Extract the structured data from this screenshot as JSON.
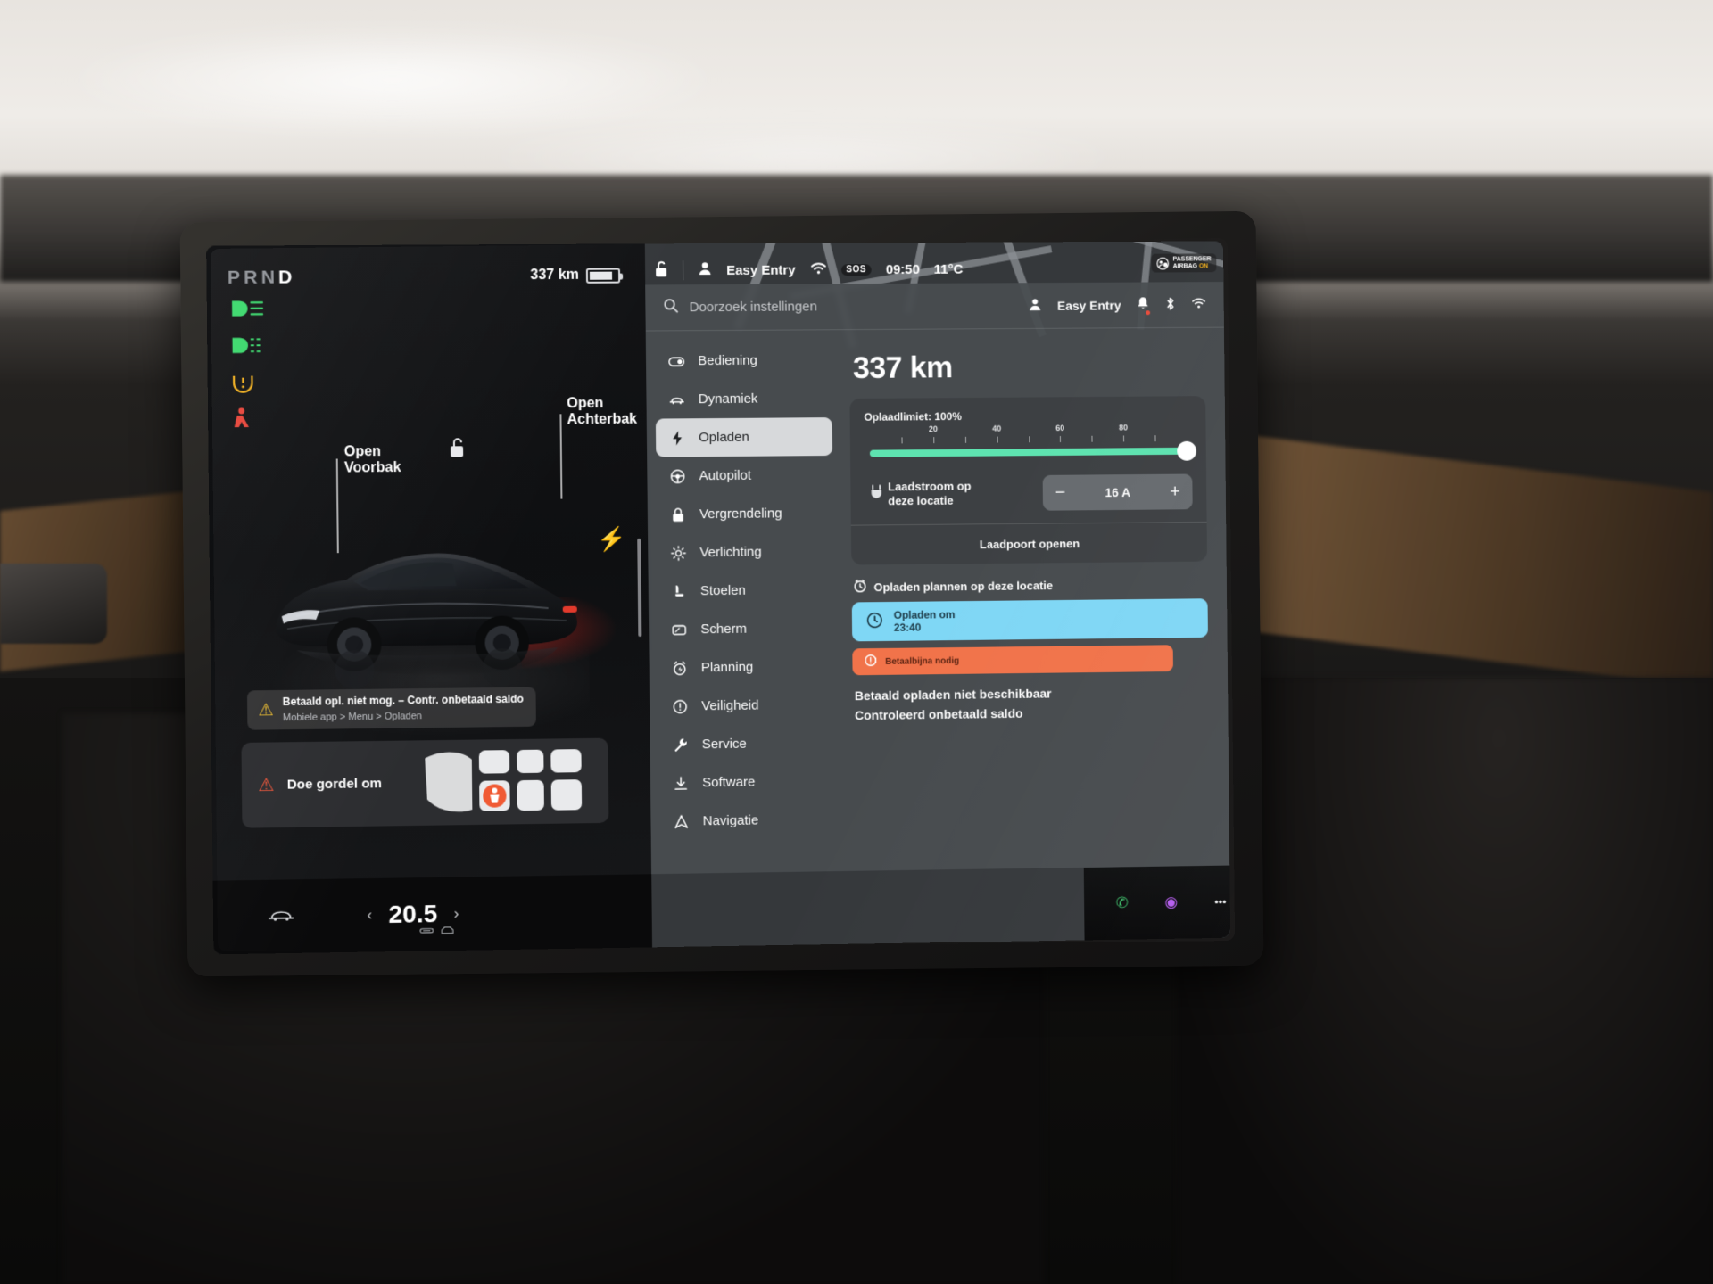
{
  "drive": {
    "gear_display": "PRND",
    "gear_active": "D",
    "range_top": "337 km",
    "telltales": [
      {
        "name": "high-beam-icon",
        "color": "#39d96b"
      },
      {
        "name": "fog-light-icon",
        "color": "#39d96b"
      },
      {
        "name": "tire-pressure-icon",
        "color": "#f2b01e"
      },
      {
        "name": "seatbelt-warning-icon",
        "color": "#e8453a"
      }
    ],
    "frunk_label": "Open\nVoorbak",
    "frunk_label_l1": "Open",
    "frunk_label_l2": "Voorbak",
    "trunk_label_l1": "Open",
    "trunk_label_l2": "Achterbak",
    "warn_card_title": "Betaald opl. niet mog. – Contr. onbetaald saldo",
    "warn_card_sub": "Mobiele app > Menu > Opladen",
    "seatbelt_card_label": "Doe gordel om"
  },
  "statusbar": {
    "range": "337 km",
    "lock": "unlocked-lock-icon",
    "profile": "Easy Entry",
    "wifi": "wifi-icon",
    "sos": "SOS",
    "time": "09:50",
    "temperature": "11°C",
    "airbag_l1": "PASSENGER",
    "airbag_l2": "AIRBAG",
    "airbag_state": "ON"
  },
  "settings": {
    "search_placeholder": "Doorzoek instellingen",
    "profile": "Easy Entry",
    "nav": [
      {
        "label": "Bediening",
        "icon": "toggle-icon",
        "active": false
      },
      {
        "label": "Dynamiek",
        "icon": "car-icon",
        "active": false
      },
      {
        "label": "Opladen",
        "icon": "bolt-icon",
        "active": true
      },
      {
        "label": "Autopilot",
        "icon": "steering-wheel-icon",
        "active": false
      },
      {
        "label": "Vergrendeling",
        "icon": "lock-icon",
        "active": false
      },
      {
        "label": "Verlichting",
        "icon": "sun-icon",
        "active": false
      },
      {
        "label": "Stoelen",
        "icon": "seat-icon",
        "active": false
      },
      {
        "label": "Scherm",
        "icon": "display-icon",
        "active": false
      },
      {
        "label": "Planning",
        "icon": "alarm-icon",
        "active": false
      },
      {
        "label": "Veiligheid",
        "icon": "shield-icon",
        "active": false
      },
      {
        "label": "Service",
        "icon": "wrench-icon",
        "active": false
      },
      {
        "label": "Software",
        "icon": "download-icon",
        "active": false
      },
      {
        "label": "Navigatie",
        "icon": "navigation-icon",
        "active": false
      }
    ]
  },
  "charging": {
    "range": "337 km",
    "limit_label": "Oplaadlimiet: 100%",
    "limit_percent": 100,
    "tick_labels": [
      "20",
      "40",
      "60",
      "80"
    ],
    "tick_positions": [
      20,
      40,
      60,
      80
    ],
    "amp_label_l1": "Laadstroom op",
    "amp_label_l2": "deze locatie",
    "amp_value": "16 A",
    "minus": "−",
    "plus": "+",
    "open_port_button": "Laadpoort openen",
    "schedule_header": "Opladen plannen op deze locatie",
    "schedule_button_l1": "Opladen om",
    "schedule_button_l2": "23:40",
    "alert_badge": "Betaalbijna nodig",
    "alert_line1": "Betaald opladen niet beschikbaar",
    "alert_line2": "Controleerd onbetaald saldo"
  },
  "dock": {
    "apps": [
      {
        "name": "phone-icon",
        "glyph": "✆",
        "color": "#3ec46d",
        "bg": "transparent"
      },
      {
        "name": "media-icon",
        "glyph": "◉",
        "color": "#b55cf0",
        "bg": "transparent"
      },
      {
        "name": "more-icon",
        "glyph": "•••",
        "color": "#e6e8ea",
        "bg": "transparent"
      },
      {
        "name": "camera-icon",
        "glyph": "◎",
        "color": "#e8e9eb",
        "bg": "#3a3b3d"
      },
      {
        "name": "energy-icon",
        "glyph": "〜",
        "color": "#0b2f16",
        "bg": "#49d96a"
      },
      {
        "name": "calendar-icon",
        "glyph": "▢",
        "color": "#0b3a44",
        "bg": "#5fe0f5"
      },
      {
        "name": "music-icon",
        "glyph": "♪",
        "color": "#fff",
        "bg": "#f0407a"
      }
    ],
    "volume_icon": "mute-icon",
    "prev": "‹",
    "next": "›"
  },
  "climate": {
    "car_icon": "car-icon",
    "prev": "‹",
    "temperature": "20.5",
    "next": "›",
    "vent_icons": [
      "vent-face-icon",
      "vent-windshield-icon"
    ]
  }
}
